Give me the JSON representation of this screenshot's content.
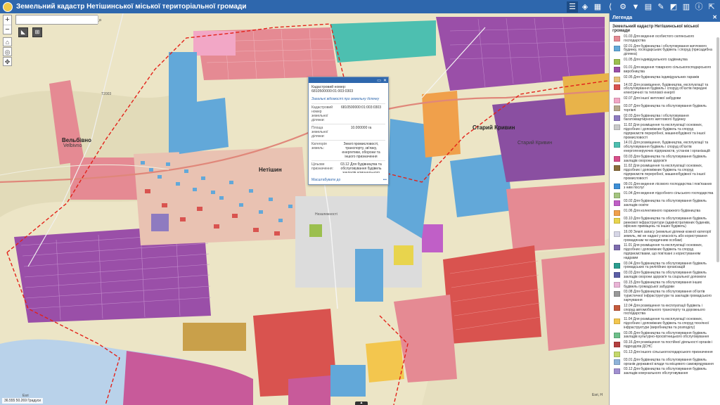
{
  "header": {
    "title": "Земельний кадастр Нетішинської міської територіальної громади",
    "tools": [
      "list-icon",
      "layers-icon",
      "basemap-icon",
      "share-icon",
      "measure-icon",
      "filter-icon",
      "print-icon",
      "draw-icon",
      "query-icon",
      "chart-icon",
      "info-icon",
      "expand-icon"
    ]
  },
  "map": {
    "search_placeholder": "",
    "zoom_in": "+",
    "zoom_out": "−",
    "places": {
      "velbivno": "Вельбівно",
      "velbivno_lat": "Velbivno",
      "netishyn": "Нетішин",
      "staryi_krupets": "Старий Кривин",
      "staryi_krupets2": "Старий Кривин"
    },
    "road_label": "Незалежності",
    "road_number": "Т2003",
    "scale_text": "36.555 50.269 Градуси",
    "esri": "Esri",
    "credits": "Esri, H"
  },
  "popup": {
    "title": "Кадастровий номер: 6810500000:01:003:0303",
    "subheading": "Загальні відомості про земельну ділянку",
    "rows": [
      {
        "k": "Кадастровий номер земельної ділянки:",
        "v": "6810500000:01:003:0303"
      },
      {
        "k": "Площа земельної ділянки:",
        "v": "10.000000 га"
      },
      {
        "k": "Категорія земель:",
        "v": "Землі промисловості, транспорту, зв'язку, енергетики, оборони та іншого призначення"
      },
      {
        "k": "Цільове призначення:",
        "v": "03.12 Для будівництва та обслуговування будівель закладів комунального обслуговування"
      }
    ],
    "zoom_link": "Масштабувати до",
    "more": "•••"
  },
  "legend": {
    "title": "Легенда",
    "subtitle": "Земельний кадастр Нетішинської міської громади",
    "items": [
      {
        "color": "#e58a93",
        "text": "01.03 Для ведення особистого селянського господарства"
      },
      {
        "color": "#62a8d9",
        "text": "02.01 Для будівництва і обслуговування житлового будинку, господарських будівель і споруд (присадибна ділянка)"
      },
      {
        "color": "#9bbf4e",
        "text": "01.05 Для індивідуального садівництва"
      },
      {
        "color": "#9a4fa8",
        "text": "01.01 Для ведення товарного сільськогосподарського виробництва"
      },
      {
        "color": "#e7c17a",
        "text": "02.05 Для будівництва індивідуальних гаражів"
      },
      {
        "color": "#d9534f",
        "text": "14.02 Для розміщення, будівництва, експлуатації та обслуговування будівель і споруд об'єктів передачі електричної та теплової енергії"
      },
      {
        "color": "#f2a7c6",
        "text": "02.07 Для іншої житлової забудови"
      },
      {
        "color": "#b6a98c",
        "text": "03.07 Для будівництва та обслуговування будівель торгівлі"
      },
      {
        "color": "#8e7bc0",
        "text": "02.03 Для будівництва і обслуговування багатоквартирного житлового будинку"
      },
      {
        "color": "#c9c9c9",
        "text": "11.02 Для розміщення та експлуатації основних, підсобних і допоміжних будівель та споруд підприємств переробної, машинобудівної та іншої промисловості"
      },
      {
        "color": "#4dbfb0",
        "text": "14.01 Для розміщення, будівництва, експлуатації та обслуговування будівель і споруд об'єктів енергогенеруючих підприємств, установ і організацій"
      },
      {
        "color": "#d84f8a",
        "text": "03.03 Для будівництва та обслуговування будівель закладів охорони здоров'я"
      },
      {
        "color": "#8a6d3b",
        "text": "11.02 Для розміщення та експлуатації основних, підсобних і допоміжних будівель та споруд підприємств переробної, машинобудівної та іншої промисловості"
      },
      {
        "color": "#3d8fd6",
        "text": "09.01 Для ведення лісового господарства і пов'язаних з ним послуг"
      },
      {
        "color": "#a4c57f",
        "text": "01.04 Для ведення підсобного сільського господарства"
      },
      {
        "color": "#c05fc7",
        "text": "03.02 Для будівництва та обслуговування будівель закладів освіти"
      },
      {
        "color": "#f0a04b",
        "text": "01.06 Для колективного гаражного будівництва"
      },
      {
        "color": "#e8d44d",
        "text": "03.10 Для будівництва та обслуговування будівель ринкової інфраструктури (адміністративних будинків, офісних приміщень та інших будівель)"
      },
      {
        "color": "#d6d6e6",
        "text": "16.00 Землі запасу (земельні ділянки кожної категорії земель, які не надані у власність або користування громадянам чи юридичним особам)"
      },
      {
        "color": "#7d6cae",
        "text": "11.01 Для розміщення та експлуатації основних, підсобних і допоміжних будівель та споруд підприємствами, що пов'язані з користуванням надрами"
      },
      {
        "color": "#2a9d8f",
        "text": "03.04 Для будівництва та обслуговування будівель громадських та релігійних організацій"
      },
      {
        "color": "#5b5ea6",
        "text": "03.03 Для будівництва та обслуговування будівель закладів охорони здоров'я та соціальної допомоги"
      },
      {
        "color": "#e9b4d6",
        "text": "03.15 Для будівництва та обслуговування інших будівель громадської забудови"
      },
      {
        "color": "#999999",
        "text": "03.08 Для будівництва та обслуговування об'єктів туристичної інфраструктури та закладів громадського харчування"
      },
      {
        "color": "#c45a3c",
        "text": "12.04 Для розміщення та експлуатації будівель і споруд автомобільного транспорту та дорожнього господарства"
      },
      {
        "color": "#f3c64e",
        "text": "11.04 Для розміщення та експлуатації основних, підсобних і допоміжних будівель та споруд технічної інфраструктури (виробництва та розподілу)"
      },
      {
        "color": "#6dbf8a",
        "text": "03.05 Для будівництва та обслуговування будівель закладів культурно-просвітницького обслуговування"
      },
      {
        "color": "#b43f3f",
        "text": "03.16 Для розміщення та постійної діяльності органів і підрозділів ДСНС"
      },
      {
        "color": "#c4d86a",
        "text": "01.13 Для іншого сільськогосподарського призначення"
      },
      {
        "color": "#8fb3d9",
        "text": "03.01 Для будівництва та обслуговування будівель органів державної влади та місцевого самоврядування"
      },
      {
        "color": "#a08fd0",
        "text": "03.12 Для будівництва та обслуговування будівель закладів комунального обслуговування"
      }
    ]
  },
  "colors": {
    "brand": "#2e67ad",
    "pink": "#e58a93",
    "purple": "#9a4fa8",
    "blue": "#62a8d9",
    "red": "#d9534f"
  }
}
